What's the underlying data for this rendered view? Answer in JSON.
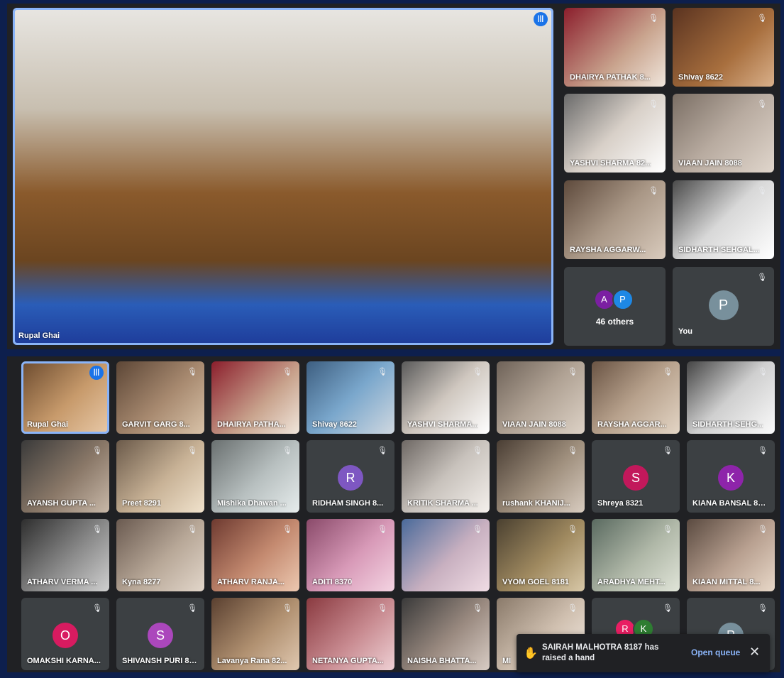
{
  "spotlight": {
    "name": "Rupal Ghai",
    "bg": "linear-gradient(180deg,#e8e6e2 0%,#c8bfb0 30%,#8a5a2c 55%,#6b4520 75%,#2a5db8 88%,#1e3c9a 100%)"
  },
  "sidebar_tiles": [
    {
      "name": "DHAIRYA PATHAK 8...",
      "bg": "linear-gradient(135deg,#8b1e2c,#c9a48e 60%,#f0e6dc)"
    },
    {
      "name": "Shivay 8622",
      "bg": "linear-gradient(135deg,#5a3320,#a86f3e 60%,#d9b08a)"
    },
    {
      "name": "YASHVI SHARMA 82...",
      "bg": "linear-gradient(135deg,#6a6a6a,#d8d0c8 50%,#ffffff)"
    },
    {
      "name": "VIAAN JAIN 8088",
      "bg": "linear-gradient(135deg,#7a6e64,#b8aba0 50%,#e0d6cc)"
    },
    {
      "name": "RAYSHA AGGARW...",
      "bg": "linear-gradient(135deg,#5e4a3c,#a99786 50%,#d9cbbd)"
    },
    {
      "name": "SIDHARTH SEHGAL...",
      "bg": "linear-gradient(135deg,#4a4a4a,#d8d8d8 50%,#ffffff)"
    }
  ],
  "others_tile": {
    "count_label": "46 others",
    "avatars": [
      {
        "letter": "A",
        "color": "#7b1fa2"
      },
      {
        "letter": "P",
        "color": "#1e88e5"
      }
    ]
  },
  "you_tile": {
    "name": "You",
    "letter": "P",
    "color": "#78909c"
  },
  "grid": [
    {
      "name": "Rupal Ghai",
      "bg": "linear-gradient(135deg,#6b4a2e,#c79a6b 55%,#e8c9a8)",
      "active": true,
      "speaking": true
    },
    {
      "name": "GARVIT GARG 8...",
      "bg": "linear-gradient(135deg,#5c4636,#a88a70 55%,#d8c2a8)"
    },
    {
      "name": "DHAIRYA PATHA...",
      "bg": "linear-gradient(135deg,#8b1e2c,#c9a48e 60%,#f0e6dc)"
    },
    {
      "name": "Shivay 8622",
      "bg": "linear-gradient(135deg,#3d5e80,#7aa7cc 50%,#d0d8e0)"
    },
    {
      "name": "YASHVI SHARMA...",
      "bg": "linear-gradient(135deg,#5a5a5a,#cfc7bf 50%,#ffffff)"
    },
    {
      "name": "VIAAN JAIN 8088",
      "bg": "linear-gradient(135deg,#6e6258,#b0a294 50%,#ddd2c6)"
    },
    {
      "name": "RAYSHA AGGAR...",
      "bg": "linear-gradient(135deg,#6a5444,#b7a18c 50%,#e3d5c5)"
    },
    {
      "name": "SIDHARTH SEHG...",
      "bg": "linear-gradient(135deg,#444,#cfcfcf 50%,#fafafa)"
    },
    {
      "name": "AYANSH GUPTA ...",
      "bg": "linear-gradient(135deg,#3a3a3a,#8a7868 55%,#c8b8a8)"
    },
    {
      "name": "Preet 8291",
      "bg": "linear-gradient(135deg,#6b5a4a,#c8b296 55%,#f0e2cc)"
    },
    {
      "name": "Mishika Dhawan ...",
      "bg": "linear-gradient(135deg,#6a7070,#b8c0c0 55%,#e6ecec)"
    },
    {
      "name": "RIDHAM SINGH 8...",
      "avatar": "R",
      "color": "#7e57c2"
    },
    {
      "name": "KRITIK SHARMA ...",
      "bg": "linear-gradient(135deg,#6e6864,#c8c2bc 50%,#f4f0ec)"
    },
    {
      "name": "rushank KHANIJ...",
      "bg": "linear-gradient(135deg,#4a3e34,#a0907e 55%,#d8ccc0)"
    },
    {
      "name": "Shreya 8321",
      "avatar": "S",
      "color": "#c2185b"
    },
    {
      "name": "KIANA BANSAL 82...",
      "avatar": "K",
      "color": "#8e24aa"
    },
    {
      "name": "ATHARV VERMA ...",
      "bg": "linear-gradient(135deg,#2e2e2e,#8a8a8a 55%,#cfcfcf)"
    },
    {
      "name": "Kyna 8277",
      "bg": "linear-gradient(135deg,#6a5a50,#b8a898 55%,#e2d6ca)"
    },
    {
      "name": "ATHARV RANJA...",
      "bg": "linear-gradient(135deg,#6e3a30,#c48a70 55%,#ecc8b0)"
    },
    {
      "name": "ADITI 8370",
      "bg": "linear-gradient(135deg,#8a4a6a,#d89ab8 55%,#f4d4e2)"
    },
    {
      "name": "",
      "bg": "linear-gradient(135deg,#4a6a9a,#c8b0c0 55%,#f0dce4)"
    },
    {
      "name": "VYOM GOEL 8181",
      "bg": "linear-gradient(135deg,#4a4030,#a08a60 55%,#d8c8a8)"
    },
    {
      "name": "ARADHYA MEHT...",
      "bg": "linear-gradient(135deg,#5a6a60,#b0b8a8 55%,#e0e4d8)"
    },
    {
      "name": "KIAAN MITTAL 8...",
      "bg": "linear-gradient(135deg,#5a4a40,#b8a090 55%,#e8d8c8)"
    },
    {
      "name": "OMAKSHI KARNA...",
      "avatar": "O",
      "color": "#d81b60"
    },
    {
      "name": "SHIVANSH PURI 81...",
      "avatar": "S",
      "color": "#ab47bc"
    },
    {
      "name": "Lavanya Rana 82...",
      "bg": "linear-gradient(135deg,#5a4030,#b09070 55%,#e0c8b0)"
    },
    {
      "name": "NETANYA GUPTA...",
      "bg": "linear-gradient(135deg,#8a3a40,#c88a90 55%,#eed0d4)"
    },
    {
      "name": "NAISHA BHATTA...",
      "bg": "linear-gradient(135deg,#3a3a3a,#9a8a80 55%,#d8ccc4)"
    },
    {
      "name": "MI",
      "bg": "linear-gradient(135deg,#8a7a6a,#d0c0b0 55%,#f4ece4)"
    },
    {
      "name": "",
      "avatars": [
        {
          "letter": "R",
          "color": "#e91e63"
        },
        {
          "letter": "K",
          "color": "#2e7d32"
        }
      ]
    },
    {
      "name": "",
      "avatar": "P",
      "color": "#78909c"
    }
  ],
  "toast": {
    "message": "SAIRAH MALHOTRA 8187 has raised a hand",
    "action": "Open queue",
    "close": "✕"
  }
}
